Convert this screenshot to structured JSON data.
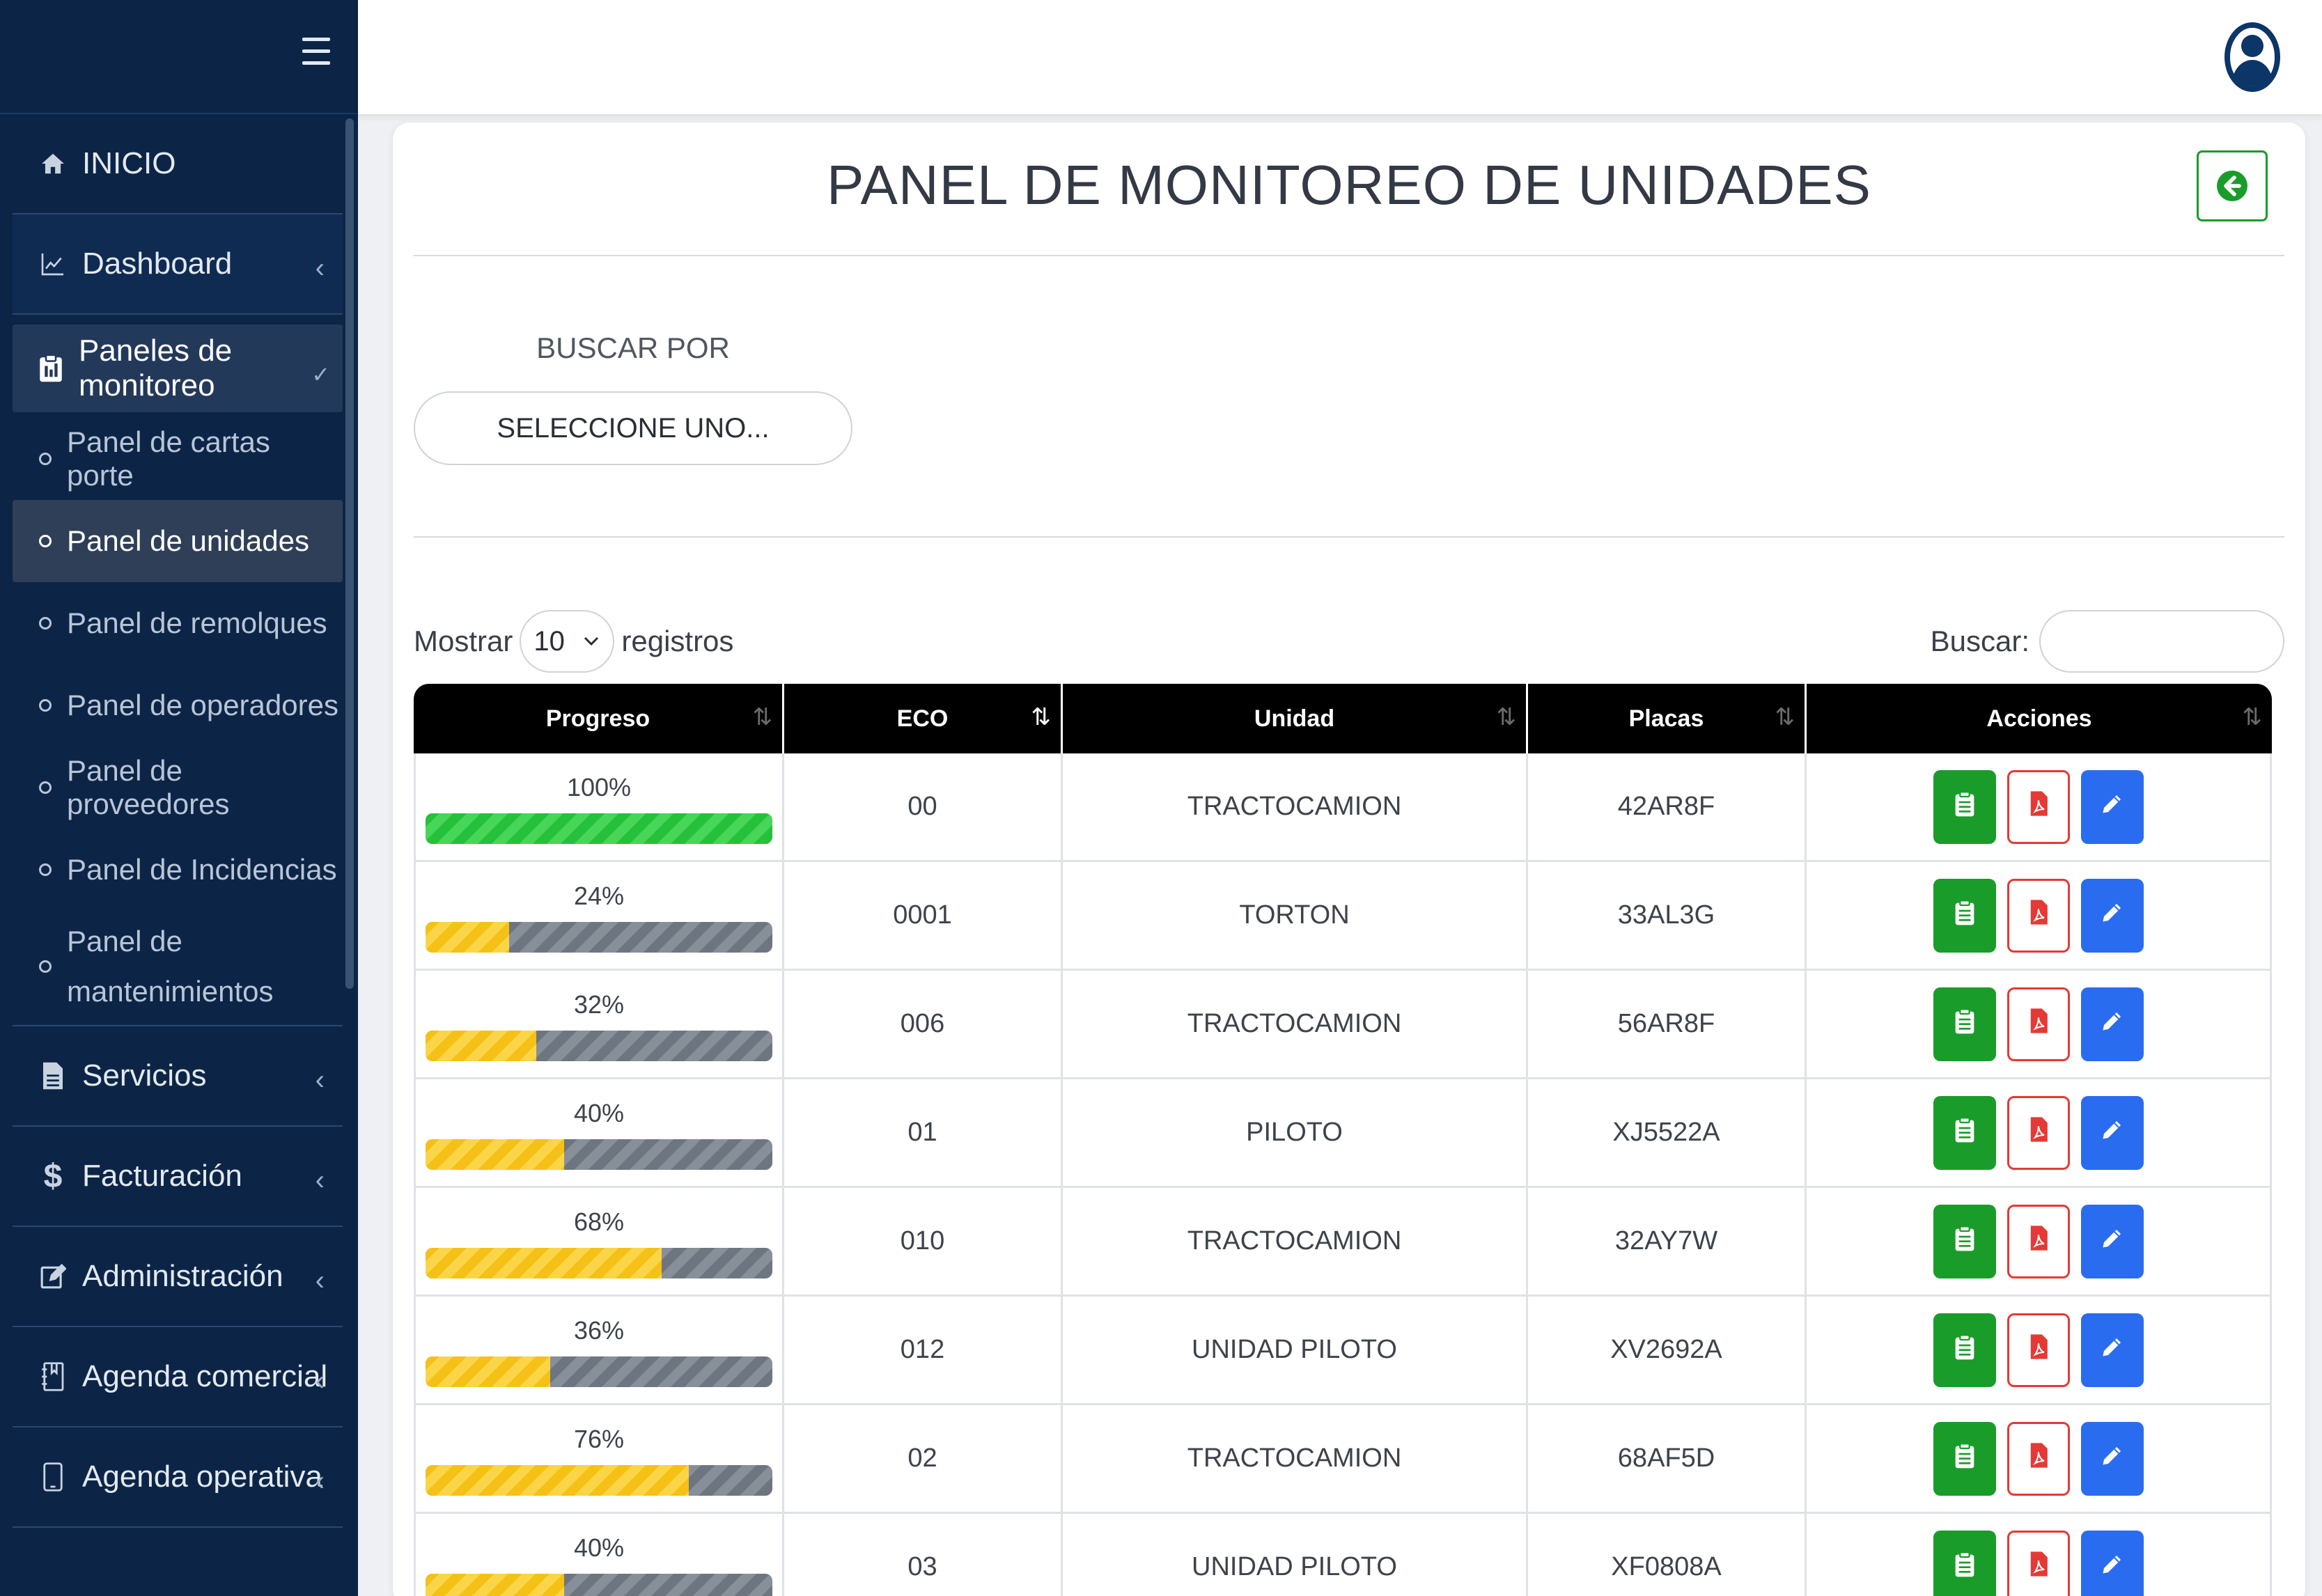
{
  "sidebar": {
    "items": [
      {
        "label": "INICIO",
        "icon": "home-icon"
      },
      {
        "label": "Dashboard",
        "icon": "chart-line-icon"
      },
      {
        "label": "Paneles de monitoreo",
        "icon": "clipboard-icon"
      },
      {
        "label": "Servicios",
        "icon": "file-icon"
      },
      {
        "label": "Facturación",
        "icon": "dollar-icon"
      },
      {
        "label": "Administración",
        "icon": "edit-icon"
      },
      {
        "label": "Agenda comercial",
        "icon": "notebook-icon"
      },
      {
        "label": "Agenda operativa",
        "icon": "tablet-icon"
      }
    ],
    "submenu": [
      {
        "label": "Panel de cartas porte"
      },
      {
        "label": "Panel de unidades"
      },
      {
        "label": "Panel de remolques"
      },
      {
        "label": "Panel de operadores"
      },
      {
        "label": "Panel de proveedores"
      },
      {
        "label": "Panel de Incidencias"
      },
      {
        "label": "Panel de mantenimientos"
      }
    ]
  },
  "main": {
    "title": "PANEL DE MONITOREO DE UNIDADES",
    "buscar_por": "BUSCAR POR",
    "select_value": "SELECCIONE UNO...",
    "mostrar": "Mostrar",
    "page_length": "10",
    "registros": "registros",
    "buscar": "Buscar:"
  },
  "table": {
    "headers": [
      "Progreso",
      "ECO",
      "Unidad",
      "Placas",
      "Acciones"
    ],
    "rows": [
      {
        "progreso": "100%",
        "value": 100,
        "eco": "00",
        "unidad": "TRACTOCAMION",
        "placas": "42AR8F"
      },
      {
        "progreso": "24%",
        "value": 24,
        "eco": "0001",
        "unidad": "TORTON",
        "placas": "33AL3G"
      },
      {
        "progreso": "32%",
        "value": 32,
        "eco": "006",
        "unidad": "TRACTOCAMION",
        "placas": "56AR8F"
      },
      {
        "progreso": "40%",
        "value": 40,
        "eco": "01",
        "unidad": "PILOTO",
        "placas": "XJ5522A"
      },
      {
        "progreso": "68%",
        "value": 68,
        "eco": "010",
        "unidad": "TRACTOCAMION",
        "placas": "32AY7W"
      },
      {
        "progreso": "36%",
        "value": 36,
        "eco": "012",
        "unidad": "UNIDAD PILOTO",
        "placas": "XV2692A"
      },
      {
        "progreso": "76%",
        "value": 76,
        "eco": "02",
        "unidad": "TRACTOCAMION",
        "placas": "68AF5D"
      },
      {
        "progreso": "40%",
        "value": 40,
        "eco": "03",
        "unidad": "UNIDAD PILOTO",
        "placas": "XF0808A"
      }
    ]
  },
  "colors": {
    "sidebar_bg": "#0c2547",
    "progress_yellow": "#f5c116",
    "progress_green": "#25c13a",
    "progress_gray": "#6d7680",
    "btn_green": "#1a9c2a",
    "btn_red": "#e53935",
    "btn_blue": "#2a6cf0"
  }
}
